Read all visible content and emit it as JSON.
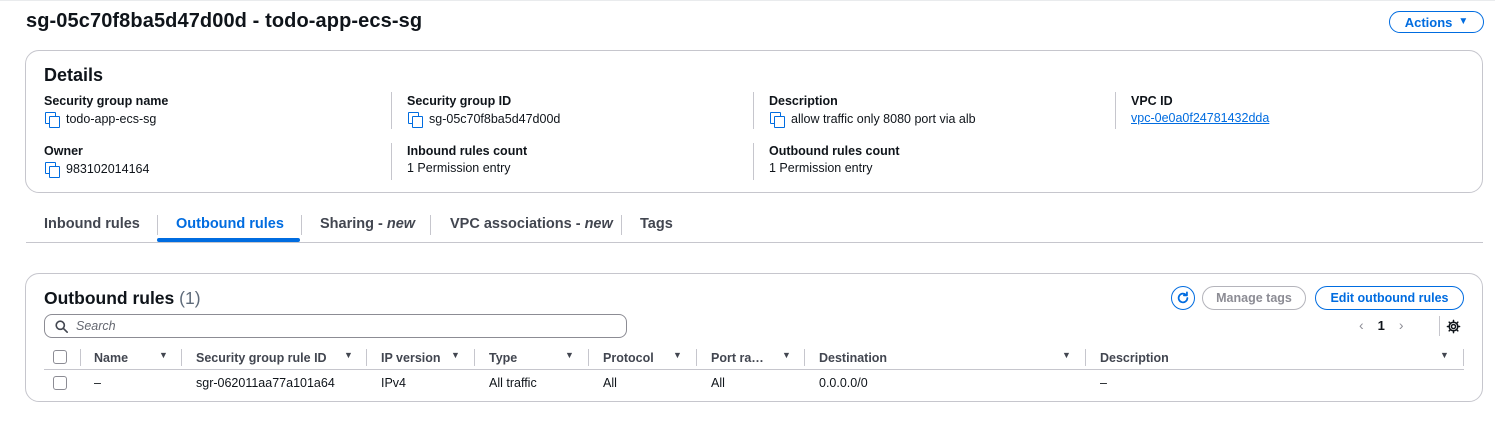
{
  "header": {
    "title": "sg-05c70f8ba5d47d00d - todo-app-ecs-sg",
    "actions_label": "Actions"
  },
  "details": {
    "title": "Details",
    "fields": [
      {
        "label": "Security group name",
        "value": "todo-app-ecs-sg"
      },
      {
        "label": "Security group ID",
        "value": "sg-05c70f8ba5d47d00d"
      },
      {
        "label": "Description",
        "value": "allow traffic only 8080 port via alb"
      },
      {
        "label": "VPC ID",
        "value": "vpc-0e0a0f24781432dda"
      },
      {
        "label": "Owner",
        "value": "983102014164"
      },
      {
        "label": "Inbound rules count",
        "value": "1 Permission entry"
      },
      {
        "label": "Outbound rules count",
        "value": "1 Permission entry"
      }
    ]
  },
  "tabs": [
    {
      "label": "Inbound rules",
      "suffix": ""
    },
    {
      "label": "Outbound rules",
      "suffix": ""
    },
    {
      "label": "Sharing - ",
      "suffix": "new"
    },
    {
      "label": "VPC associations - ",
      "suffix": "new"
    },
    {
      "label": "Tags",
      "suffix": ""
    }
  ],
  "active_tab": "Outbound rules",
  "outbound": {
    "title": "Outbound rules",
    "count": "(1)",
    "manage_tags_label": "Manage tags",
    "edit_label": "Edit outbound rules",
    "search_placeholder": "Search",
    "current_page": "1",
    "columns": [
      "Name",
      "Security group rule ID",
      "IP version",
      "Type",
      "Protocol",
      "Port ra…",
      "Destination",
      "Description"
    ],
    "rows": [
      [
        "–",
        "sgr-062011aa77a101a64",
        "IPv4",
        "All traffic",
        "All",
        "All",
        "0.0.0.0/0",
        "–"
      ]
    ]
  },
  "colors": {
    "accent": "#006ce0",
    "text": "#0f141a",
    "border": "#c6c6cd",
    "disabled": "#8c8c94"
  },
  "icons": {
    "copy": "copy-icon",
    "refresh": "refresh-icon",
    "search": "search-icon",
    "settings": "gear-icon",
    "caret": "caret-down-icon",
    "sort": "sort-down-icon"
  }
}
